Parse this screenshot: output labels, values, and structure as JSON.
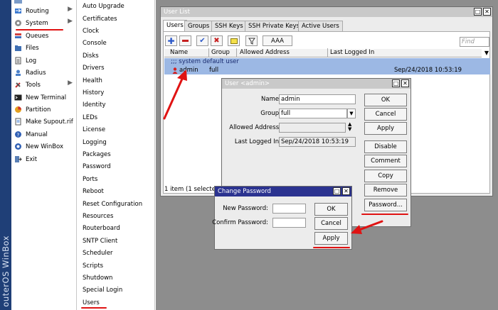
{
  "side_brand": "outerOS WinBox",
  "main_menu": [
    {
      "label": "",
      "icon": "partial-icon"
    },
    {
      "label": "Routing",
      "icon": "routing-icon",
      "arrow": "▶"
    },
    {
      "label": "System",
      "icon": "gear-icon",
      "arrow": "▶"
    },
    {
      "label": "Queues",
      "icon": "queues-icon"
    },
    {
      "label": "Files",
      "icon": "folder-icon"
    },
    {
      "label": "Log",
      "icon": "log-icon"
    },
    {
      "label": "Radius",
      "icon": "radius-icon"
    },
    {
      "label": "Tools",
      "icon": "tools-icon",
      "arrow": "▶"
    },
    {
      "label": "New Terminal",
      "icon": "terminal-icon"
    },
    {
      "label": "Partition",
      "icon": "partition-icon"
    },
    {
      "label": "Make Supout.rif",
      "icon": "document-icon"
    },
    {
      "label": "Manual",
      "icon": "help-icon"
    },
    {
      "label": "New WinBox",
      "icon": "winbox-icon"
    },
    {
      "label": "Exit",
      "icon": "exit-icon"
    }
  ],
  "system_submenu": [
    "Auto Upgrade",
    "Certificates",
    "Clock",
    "Console",
    "Disks",
    "Drivers",
    "Health",
    "History",
    "Identity",
    "LEDs",
    "License",
    "Logging",
    "Packages",
    "Password",
    "Ports",
    "Reboot",
    "Reset Configuration",
    "Resources",
    "Routerboard",
    "SNTP Client",
    "Scheduler",
    "Scripts",
    "Shutdown",
    "Special Login",
    "Users"
  ],
  "user_list": {
    "title": "User List",
    "tabs": [
      "Users",
      "Groups",
      "SSH Keys",
      "SSH Private Keys",
      "Active Users"
    ],
    "toolbar": {
      "aaa_label": "AAA",
      "find_placeholder": "Find"
    },
    "columns": [
      "Name",
      "Group",
      "Allowed Address",
      "Last Logged In"
    ],
    "comment_row": ";;; system default user",
    "rows": [
      {
        "name": "admin",
        "group": "full",
        "allowed_address": "",
        "last_logged_in": "Sep/24/2018 10:53:19"
      }
    ],
    "status": "1 item (1 selected)"
  },
  "user_dialog": {
    "title": "User <admin>",
    "name_label": "Name:",
    "name_value": "admin",
    "group_label": "Group:",
    "group_value": "full",
    "allowed_label": "Allowed Address:",
    "allowed_value": "",
    "last_label": "Last Logged In:",
    "last_value": "Sep/24/2018 10:53:19",
    "buttons": [
      "OK",
      "Cancel",
      "Apply",
      "Disable",
      "Comment",
      "Copy",
      "Remove",
      "Password..."
    ]
  },
  "change_password": {
    "title": "Change Password",
    "new_label": "New Password:",
    "confirm_label": "Confirm Password:",
    "new_value": "",
    "confirm_value": "",
    "ok": "OK",
    "cancel": "Cancel",
    "apply": "Apply"
  },
  "colors": {
    "titlebar_active": "#2b3390",
    "selection_row": "#9cb8e4",
    "highlight_underline": "#e01313",
    "side_brand_bg": "#1f3f77"
  }
}
